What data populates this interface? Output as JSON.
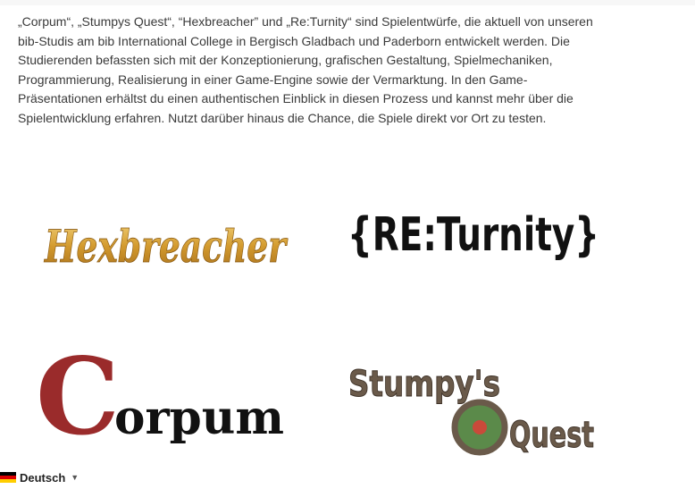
{
  "intro_text": "„Corpum“, „Stumpys Quest“, “Hexbreacher” und „Re:Turnity“  sind Spielentwürfe, die aktuell von unseren bib-Studis am bib International College in Bergisch Gladbach und Paderborn entwickelt werden. Die Studierenden befassten sich mit der Konzeptionierung, grafischen Gestaltung, Spielmechaniken, Programmierung, Realisierung in einer Game-Engine sowie der Vermarktung. In den Game-Präsentationen erhältst du einen authentischen Einblick in diesen Prozess und kannst mehr über die Spielentwicklung erfahren. Nutzt darüber hinaus die Chance, die Spiele direkt vor Ort zu testen.",
  "logos": {
    "hexbreacher": {
      "text": "Hexbreacher",
      "color": "#d9a53a"
    },
    "returnity": {
      "text": "{RE:Turnity}",
      "color": "#111111"
    },
    "corpum": {
      "initial": "C",
      "rest": "orpum",
      "initial_color": "#9a2b2b",
      "color": "#111111"
    },
    "stumpys_quest": {
      "line1": "Stumpy's",
      "line2": "Quest",
      "color": "#6a5a4a"
    }
  },
  "language_switcher": {
    "label": "Deutsch",
    "flag_colors": [
      "#000000",
      "#dd0000",
      "#ffce00"
    ],
    "icon": "chevron-down-icon"
  }
}
